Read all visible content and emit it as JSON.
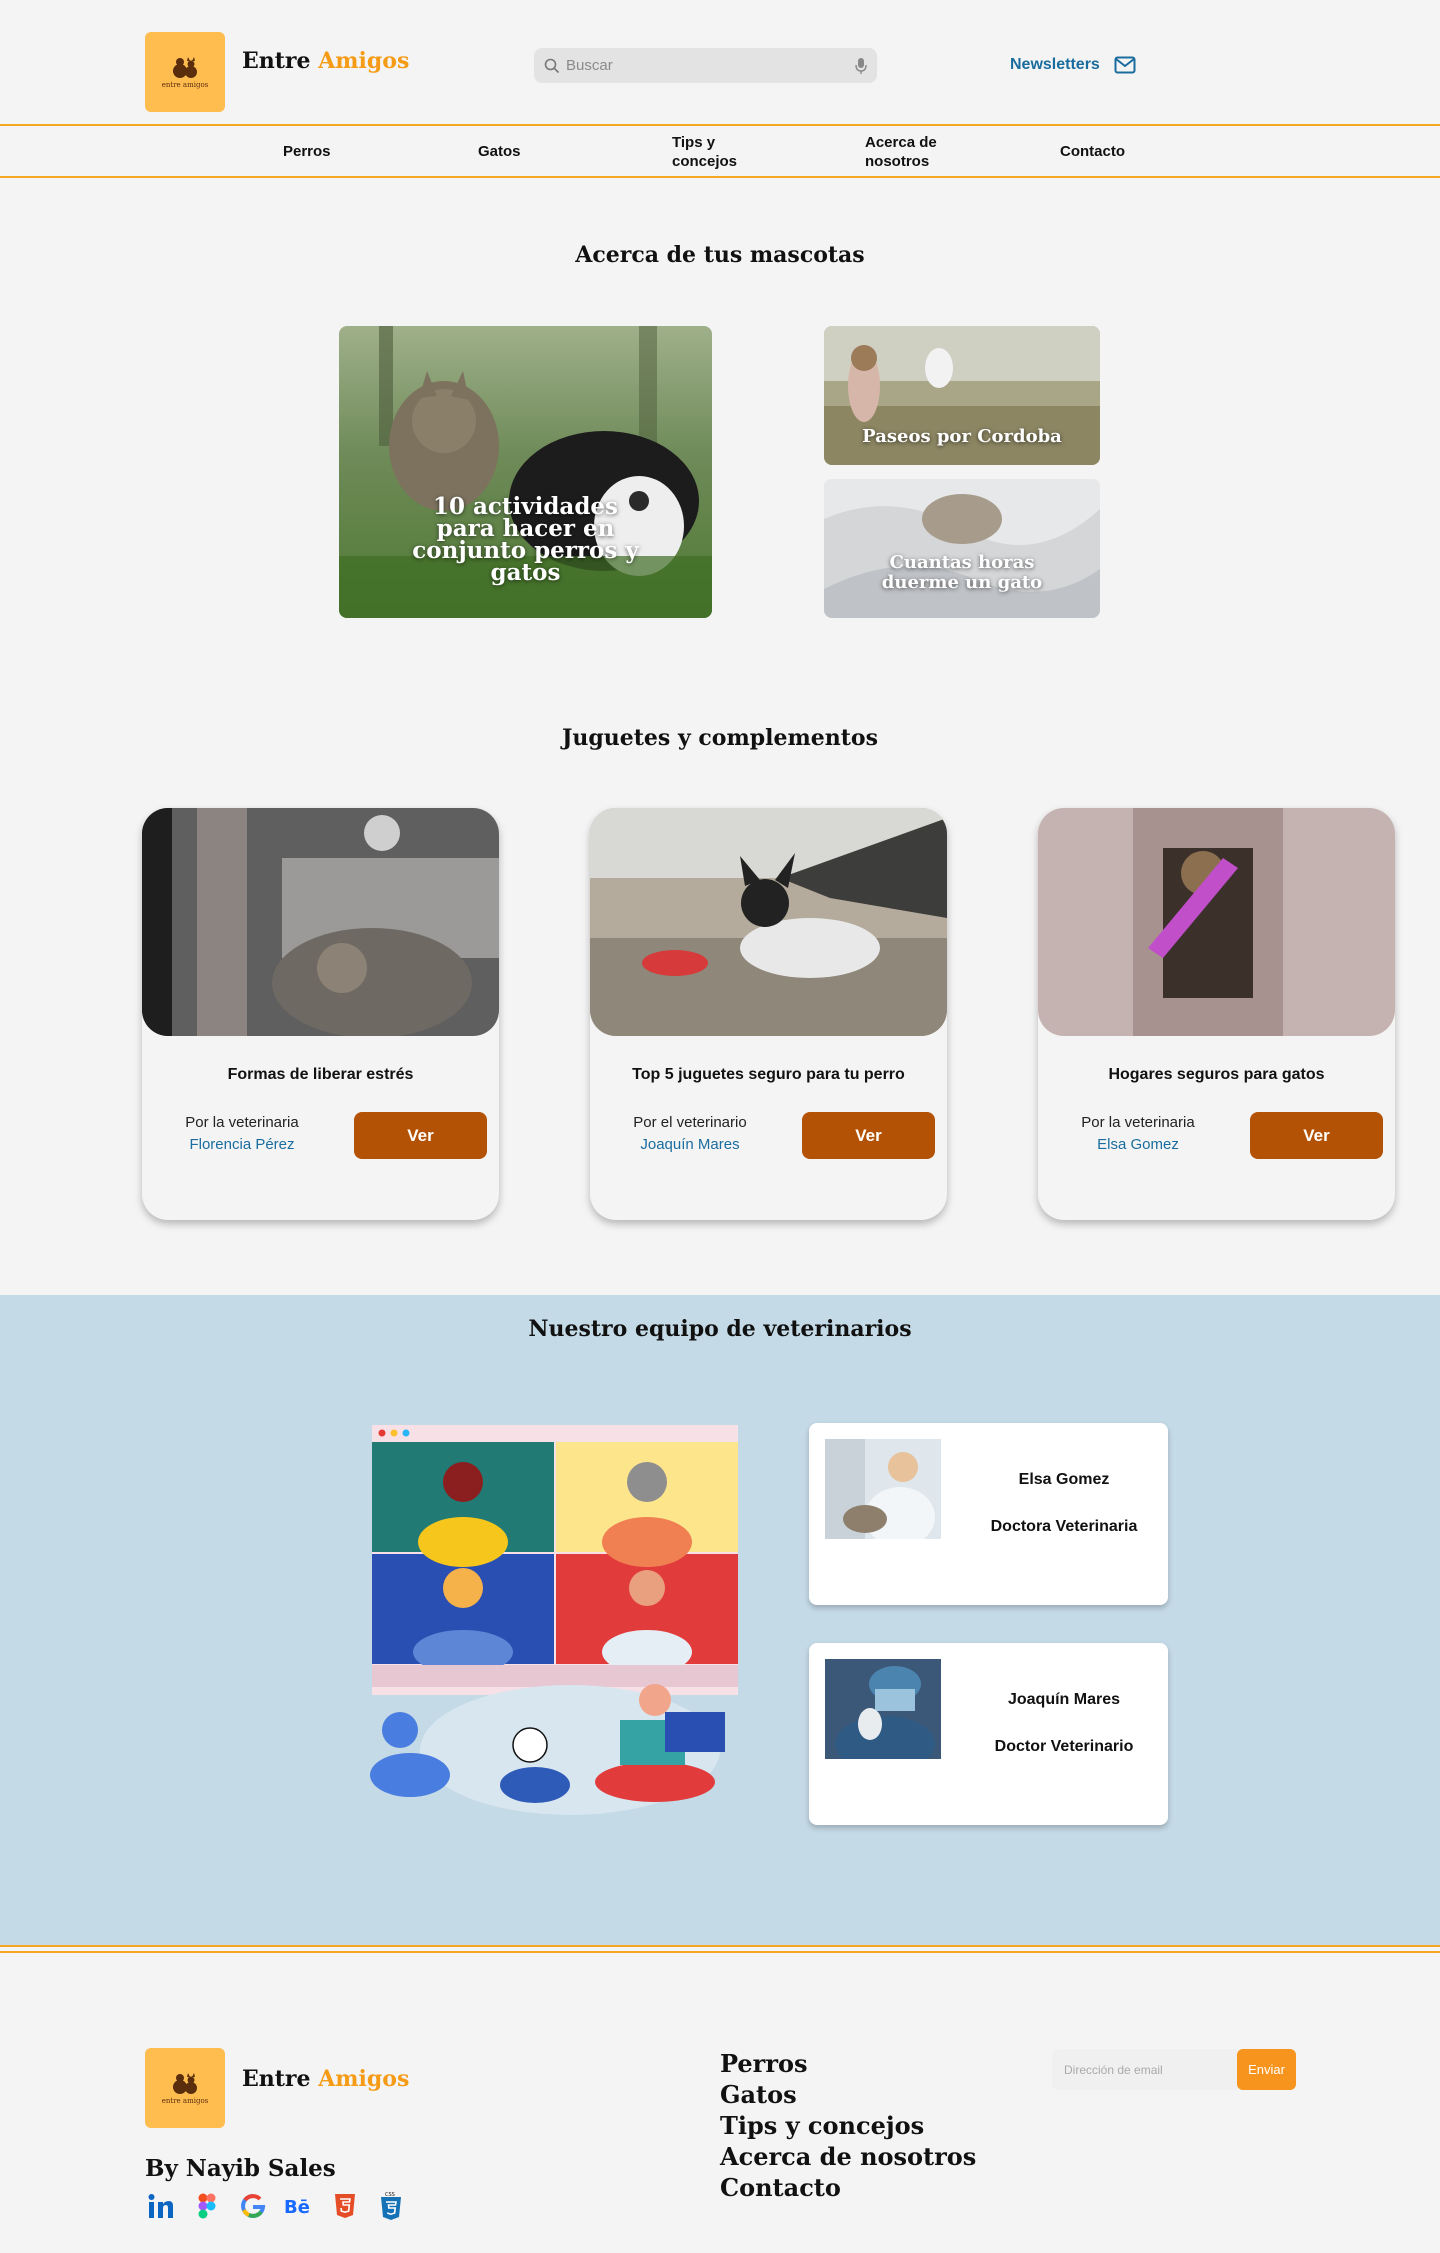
{
  "brand": {
    "name": "Entre",
    "accent": "Amigos",
    "logo_text": "entre amigos"
  },
  "header": {
    "search_placeholder": "Buscar",
    "newsletter_label": "Newsletters"
  },
  "nav": {
    "items": [
      {
        "label": "Perros"
      },
      {
        "label": "Gatos"
      },
      {
        "label": "Tips y concejos"
      },
      {
        "label": "Acerca de nosotros"
      },
      {
        "label": "Contacto"
      }
    ]
  },
  "pets_section": {
    "title": "Acerca de tus mascotas",
    "features": [
      {
        "caption": "10 actividades para hacer en conjunto perros y gatos"
      },
      {
        "caption": "Paseos por Cordoba"
      },
      {
        "caption": "Cuantas horas duerme un gato"
      }
    ]
  },
  "toys_section": {
    "title": "Juguetes y complementos",
    "cards": [
      {
        "title": "Formas de liberar estrés",
        "author_prefix": "Por la veterinaria",
        "author_name": "Florencia Pérez",
        "button": "Ver"
      },
      {
        "title": "Top 5 juguetes seguro para tu perro",
        "author_prefix": "Por el veterinario",
        "author_name": "Joaquín Mares",
        "button": "Ver"
      },
      {
        "title": "Hogares seguros para gatos",
        "author_prefix": "Por la veterinaria",
        "author_name": "Elsa Gomez",
        "button": "Ver"
      }
    ]
  },
  "team_section": {
    "title": "Nuestro equipo de veterinarios",
    "vets": [
      {
        "name": "Elsa Gomez",
        "role": "Doctora Veterinaria"
      },
      {
        "name": "Joaquín Mares",
        "role": "Doctor Veterinario"
      }
    ]
  },
  "footer": {
    "by": "By Nayib Sales",
    "social_icons": [
      "linkedin-icon",
      "figma-icon",
      "google-icon",
      "behance-icon",
      "html5-icon",
      "css3-icon"
    ],
    "links": [
      "Perros",
      "Gatos",
      "Tips y concejos",
      "Acerca de nosotros",
      "Contacto"
    ],
    "email_placeholder": "Dirección de email",
    "send_label": "Enviar"
  },
  "colors": {
    "accent_orange": "#f5a623",
    "button_brown": "#b35205",
    "link_blue": "#1a6c9e",
    "team_bg": "#c4dae6"
  }
}
